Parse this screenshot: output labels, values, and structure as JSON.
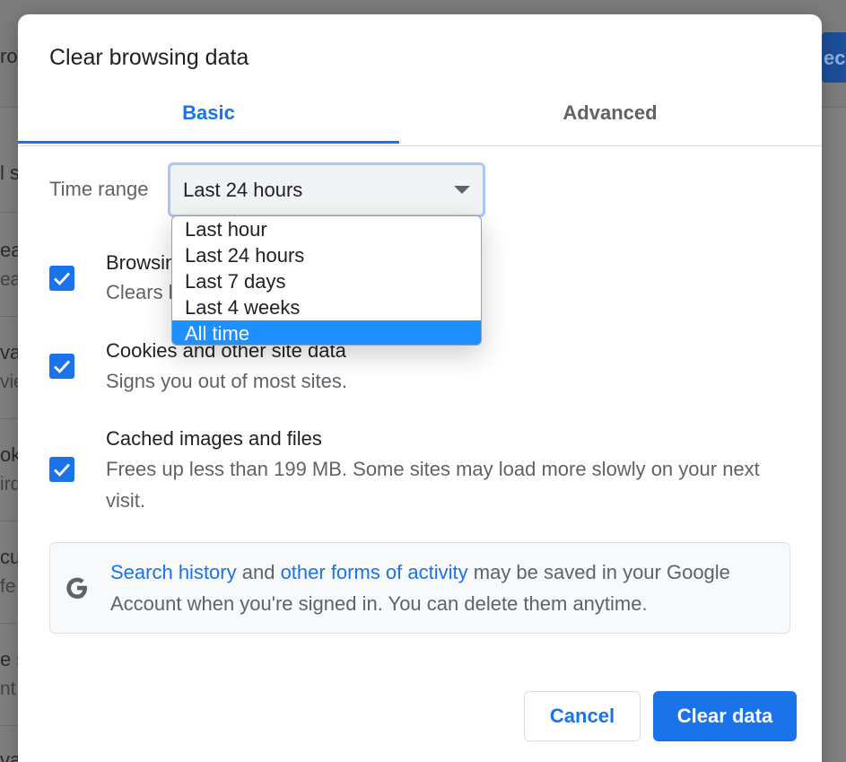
{
  "dialog": {
    "title": "Clear browsing data",
    "tabs": [
      {
        "label": "Basic",
        "active": true
      },
      {
        "label": "Advanced",
        "active": false
      }
    ]
  },
  "time_range": {
    "label": "Time range",
    "selected": "Last 24 hours",
    "options": [
      "Last hour",
      "Last 24 hours",
      "Last 7 days",
      "Last 4 weeks",
      "All time"
    ],
    "highlighted": "All time"
  },
  "items": [
    {
      "title": "Browsing history",
      "desc": "Clears history from all signed-in devices",
      "checked": true
    },
    {
      "title": "Cookies and other site data",
      "desc": "Signs you out of most sites.",
      "checked": true
    },
    {
      "title": "Cached images and files",
      "desc": "Frees up less than 199 MB. Some sites may load more slowly on your next visit.",
      "checked": true
    }
  ],
  "info": {
    "link1": "Search history",
    "and": " and ",
    "link2": "other forms of activity",
    "rest": " may be saved in your Google Account when you're signed in. You can delete them anytime."
  },
  "buttons": {
    "cancel": "Cancel",
    "clear": "Clear data"
  },
  "background": {
    "fragments": [
      "ro",
      "l s",
      "ear",
      "ear",
      "va",
      "vie",
      "ok",
      "ird",
      "cu",
      "fe",
      "e s",
      "nt",
      "va"
    ],
    "right_button_text": "ecl"
  },
  "colors": {
    "accent": "#1a73e8",
    "highlight": "#1e90ff"
  }
}
